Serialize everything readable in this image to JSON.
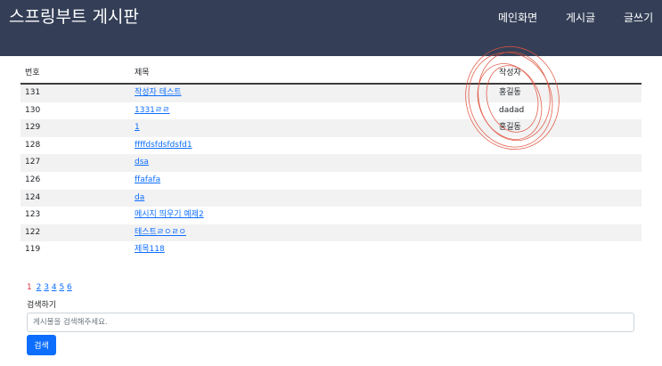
{
  "navbar": {
    "brand": "스프링부트 게시판",
    "links": [
      {
        "label": "메인화면"
      },
      {
        "label": "게시글"
      },
      {
        "label": "글쓰기"
      }
    ]
  },
  "board": {
    "columns": {
      "id": "번호",
      "title": "제목",
      "author": "작성자"
    },
    "rows": [
      {
        "id": "131",
        "title": "작성자 테스트",
        "author": "홍길동"
      },
      {
        "id": "130",
        "title": "1331ㄹㄹ",
        "author": "dadad"
      },
      {
        "id": "129",
        "title": "1",
        "author": "홍길동"
      },
      {
        "id": "128",
        "title": "ffffdsfdsfdsfd1",
        "author": ""
      },
      {
        "id": "127",
        "title": "dsa",
        "author": ""
      },
      {
        "id": "126",
        "title": "ffafafa",
        "author": ""
      },
      {
        "id": "124",
        "title": "da",
        "author": ""
      },
      {
        "id": "123",
        "title": "메시지 띄우기 예제2",
        "author": ""
      },
      {
        "id": "122",
        "title": "테스트ㄹㅇㄹㅇ",
        "author": ""
      },
      {
        "id": "119",
        "title": "제목118",
        "author": ""
      }
    ]
  },
  "pagination": {
    "pages": [
      "1",
      "2",
      "3",
      "4",
      "5",
      "6"
    ],
    "current": "1"
  },
  "search": {
    "label": "검색하기",
    "placeholder": "게시물을 검색해주세요.",
    "button": "검색"
  },
  "colors": {
    "navbar": "#343f57",
    "link": "#0d6efd",
    "current_page": "#dc3545",
    "annotation": "#e0503c"
  }
}
